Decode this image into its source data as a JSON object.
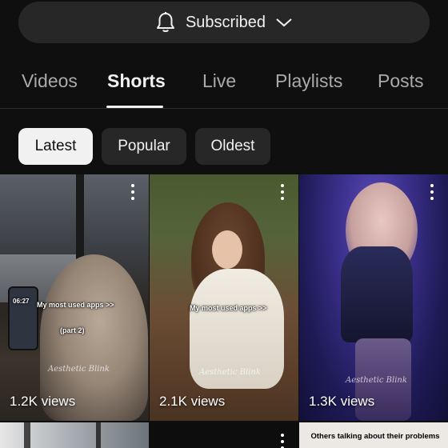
{
  "subscribe": {
    "label": "Subscribed"
  },
  "tabs": [
    {
      "label": "Videos"
    },
    {
      "label": "Shorts"
    },
    {
      "label": "Live"
    },
    {
      "label": "Playlists"
    },
    {
      "label": "Posts"
    }
  ],
  "active_tab": "Shorts",
  "chips": [
    {
      "label": "Latest"
    },
    {
      "label": "Popular"
    },
    {
      "label": "Oldest"
    }
  ],
  "selected_chip": "Latest",
  "shorts": [
    {
      "views": "1.2K views",
      "caption": "My most used apps >>",
      "caption2": "(part 2)",
      "watermark": "Aesthetic Blink",
      "phone_time": "06:27"
    },
    {
      "views": "2.1K views",
      "caption": "My most used apps >>",
      "watermark": "Aesthetic Blink"
    },
    {
      "views": "1.3K views",
      "watermark": "Aesthetic Blink"
    }
  ],
  "partial_tiles": [
    {
      "banner": "Others talking about their problems"
    }
  ]
}
